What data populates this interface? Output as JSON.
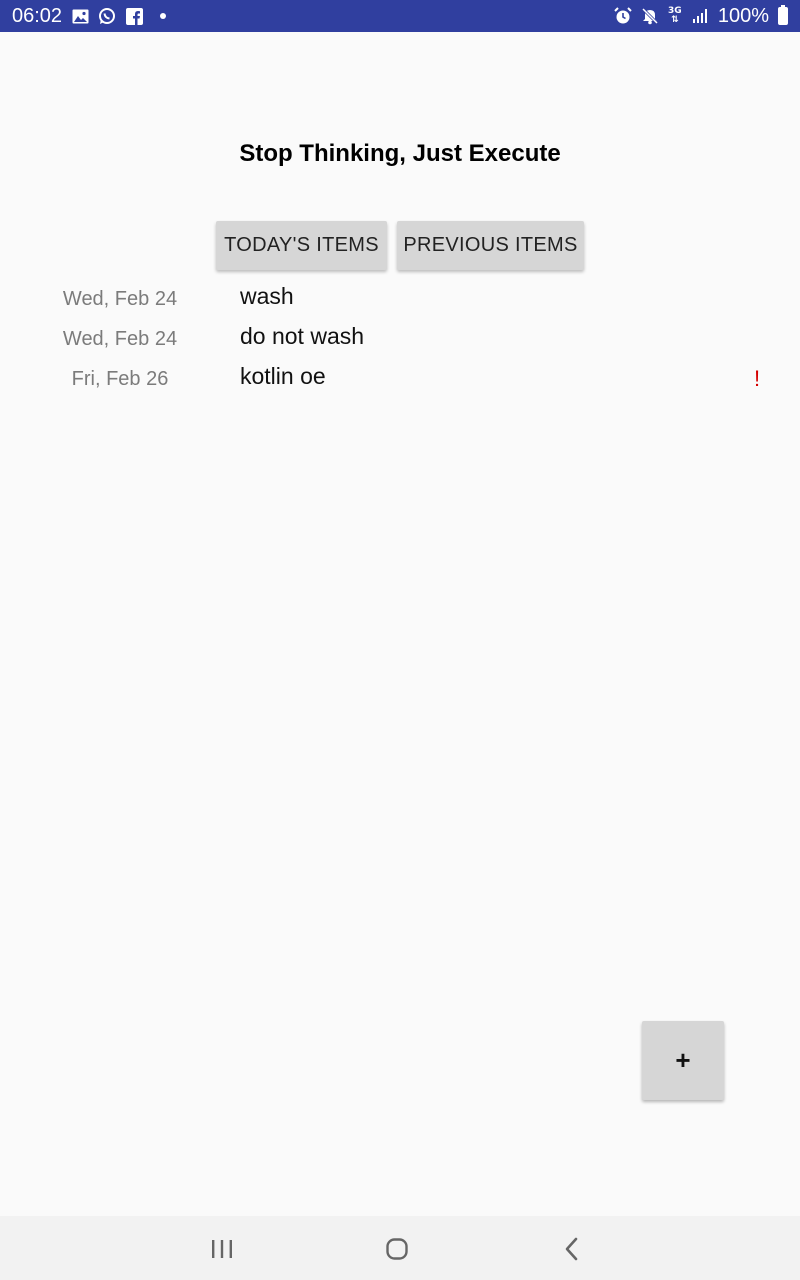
{
  "status_bar": {
    "time": "06:02",
    "left_icons": [
      "gallery-icon",
      "whatsapp-icon",
      "facebook-icon",
      "notification-dot-icon"
    ],
    "right_icons": [
      "alarm-icon",
      "mute-icon",
      "network-3g-icon",
      "signal-icon",
      "battery-icon"
    ],
    "network_label": "3G",
    "battery_percent": "100%",
    "background_color": "#303f9f"
  },
  "header": {
    "title": "Stop Thinking, Just Execute"
  },
  "tabs": {
    "today_label": "TODAY'S ITEMS",
    "previous_label": "PREVIOUS ITEMS"
  },
  "items": [
    {
      "date": "Wed, Feb 24",
      "text": "wash",
      "flag": ""
    },
    {
      "date": "Wed, Feb 24",
      "text": "do not wash",
      "flag": ""
    },
    {
      "date": "Fri, Feb 26",
      "text": "kotlin oe",
      "flag": "!"
    }
  ],
  "add_button": {
    "label": "+"
  },
  "nav_bar": {
    "icons": [
      "recents-icon",
      "home-icon",
      "back-icon"
    ]
  },
  "colors": {
    "accent": "#303f9f",
    "flag": "#d50000",
    "date_text": "#7b7b7b",
    "button_bg": "#d6d6d6"
  }
}
